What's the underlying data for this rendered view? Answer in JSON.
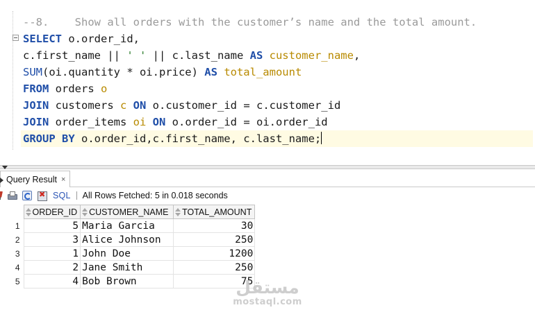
{
  "editor": {
    "lines": [
      {
        "parts": [
          {
            "t": "cmt",
            "v": "--8.    Show all orders with the customer’s name and the total amount."
          }
        ]
      },
      {
        "parts": [
          {
            "t": "kw",
            "v": "SELECT"
          },
          {
            "t": "",
            "v": " o.order_id,"
          }
        ]
      },
      {
        "parts": [
          {
            "t": "",
            "v": "c.first_name || "
          },
          {
            "t": "str",
            "v": "' '"
          },
          {
            "t": "",
            "v": " || c.last_name "
          },
          {
            "t": "kw",
            "v": "AS"
          },
          {
            "t": "",
            "v": " "
          },
          {
            "t": "al",
            "v": "customer_name"
          },
          {
            "t": "",
            "v": ","
          }
        ]
      },
      {
        "parts": [
          {
            "t": "fn",
            "v": "SUM"
          },
          {
            "t": "",
            "v": "(oi.quantity * oi.price) "
          },
          {
            "t": "kw",
            "v": "AS"
          },
          {
            "t": "",
            "v": " "
          },
          {
            "t": "al",
            "v": "total_amount"
          }
        ]
      },
      {
        "parts": [
          {
            "t": "kw",
            "v": "FROM"
          },
          {
            "t": "",
            "v": " orders "
          },
          {
            "t": "al",
            "v": "o"
          }
        ]
      },
      {
        "parts": [
          {
            "t": "kw",
            "v": "JOIN"
          },
          {
            "t": "",
            "v": " customers "
          },
          {
            "t": "al",
            "v": "c"
          },
          {
            "t": "",
            "v": " "
          },
          {
            "t": "kw",
            "v": "ON"
          },
          {
            "t": "",
            "v": " o.customer_id = c.customer_id"
          }
        ]
      },
      {
        "parts": [
          {
            "t": "kw",
            "v": "JOIN"
          },
          {
            "t": "",
            "v": " order_items "
          },
          {
            "t": "al",
            "v": "oi"
          },
          {
            "t": "",
            "v": " "
          },
          {
            "t": "kw",
            "v": "ON"
          },
          {
            "t": "",
            "v": " o.order_id = oi.order_id"
          }
        ]
      },
      {
        "parts": [
          {
            "t": "kw",
            "v": "GROUP BY"
          },
          {
            "t": "",
            "v": " o.order_id,c.first_name, c.last_name;"
          }
        ],
        "current": true
      }
    ]
  },
  "results_tab": {
    "label": "Query Result",
    "close_glyph": "×"
  },
  "toolbar": {
    "sql_label": "SQL",
    "status": "All Rows Fetched: 5 in 0.018 seconds"
  },
  "grid": {
    "columns": [
      "ORDER_ID",
      "CUSTOMER_NAME",
      "TOTAL_AMOUNT"
    ],
    "rows": [
      {
        "n": "1",
        "order_id": "5",
        "customer_name": "Maria Garcia",
        "total_amount": "30"
      },
      {
        "n": "2",
        "order_id": "3",
        "customer_name": "Alice Johnson",
        "total_amount": "250"
      },
      {
        "n": "3",
        "order_id": "1",
        "customer_name": "John Doe",
        "total_amount": "1200"
      },
      {
        "n": "4",
        "order_id": "2",
        "customer_name": "Jane Smith",
        "total_amount": "250"
      },
      {
        "n": "5",
        "order_id": "4",
        "customer_name": "Bob Brown",
        "total_amount": "75"
      }
    ]
  },
  "watermark": {
    "arabic": "مستقل",
    "latin": "mostaql.com"
  },
  "colors": {
    "keyword": "#1f4ea8",
    "alias": "#b88a00",
    "comment": "#9a9a9a",
    "string": "#2f7f2f",
    "current_line": "#fffbe3"
  }
}
